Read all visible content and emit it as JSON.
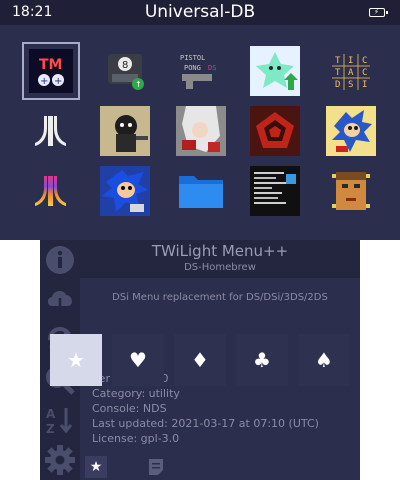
{
  "status": {
    "time": "18:21",
    "title": "Universal-DB"
  },
  "grid": {
    "row1": [
      "tm-app",
      "save-manager",
      "pistol-pong-ds",
      "green-star-ghost",
      "tic-tac-dsi"
    ],
    "row2": [
      "atari-fuji",
      "gorillaz-art",
      "devil-hunter-art",
      "red-pentagon",
      "sonic-classic"
    ],
    "row3": [
      "atari-rainbow",
      "sonic-modern",
      "folder",
      "terminal-screenshot",
      "doom-face"
    ]
  },
  "icon_text": {
    "tm": "TM",
    "pistol": "PISTOL",
    "pong": "PONG",
    "ds": "DS",
    "tic": [
      "T",
      "I",
      "C",
      "T",
      "A",
      "C",
      "D",
      "S",
      "I"
    ]
  },
  "app": {
    "name": "TWiLight Menu++",
    "subtitle": "DS-Homebrew",
    "description": "DSi Menu replacement for DS/DSi/3DS/2DS",
    "version_line": "Ver",
    "version_tail": ".0",
    "category": "Category: utility",
    "console": "Console: NDS",
    "updated": "Last updated: 2021-03-17 at 07:10 (UTC)",
    "license": "License: gpl-3.0"
  },
  "suits": {
    "star": "★",
    "heart": "♥",
    "diamond": "♦",
    "club": "♣",
    "spade": "♠"
  },
  "tabs": {
    "star": "★"
  },
  "colors": {
    "top_bg": "#2c2e4e",
    "status_bg": "#1f2038",
    "bottom_bg": "#2c2e4e",
    "selected_button": "#d6d9ea"
  }
}
